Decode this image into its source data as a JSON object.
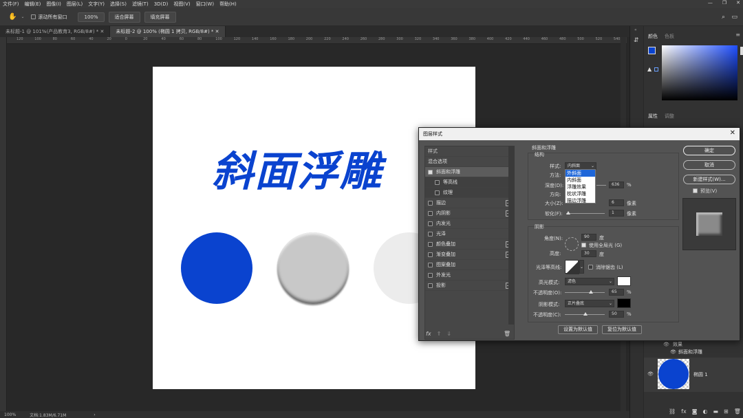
{
  "menubar": {
    "items": [
      "文件(F)",
      "编辑(E)",
      "图像(I)",
      "图层(L)",
      "文字(Y)",
      "选择(S)",
      "滤镜(T)",
      "3D(D)",
      "视图(V)",
      "窗口(W)",
      "帮助(H)"
    ],
    "window_controls": [
      "—",
      "❐",
      "✕"
    ]
  },
  "options_bar": {
    "scroll_all": "滚动所有窗口",
    "zoom": "100%",
    "fit_screen": "适合屏幕",
    "fill_screen": "填充屏幕"
  },
  "tabs": [
    "未标题-1 @ 101%(产品教育3, RGB/8#) *",
    "未标题-2 @ 100% (椭圆 1 拷贝, RGB/8#) *"
  ],
  "ruler_ticks": [
    "120",
    "100",
    "80",
    "60",
    "40",
    "20",
    "0",
    "20",
    "40",
    "60",
    "80",
    "100",
    "120",
    "140",
    "160",
    "180",
    "200",
    "220",
    "240",
    "260",
    "280",
    "300",
    "320",
    "340",
    "360",
    "380",
    "400",
    "420",
    "440",
    "460",
    "480",
    "500",
    "520",
    "540"
  ],
  "canvas": {
    "title_text": "斜面浮雕",
    "title_color": "#0a43cf",
    "circle_colors": [
      "#0a43cf",
      "#c8c8c8",
      "#ececec"
    ]
  },
  "status": {
    "zoom": "100%",
    "doc": "文档:1.83M/6.71M",
    "arrow": "›"
  },
  "right_panel": {
    "color_tabs": [
      "颜色",
      "色板"
    ],
    "props_tabs": [
      "属性",
      "调整"
    ],
    "layers": {
      "effects_label": "效果",
      "bevel_label": "斜面和浮雕",
      "layer_name": "椭圆 1"
    }
  },
  "dialog": {
    "title": "图层样式",
    "close": "✕",
    "styles_header": "样式",
    "blend_options": "混合选项",
    "bevel": "斜面和浮雕",
    "contour": "等高线",
    "texture": "纹理",
    "effects": [
      "描边",
      "内阴影",
      "内发光",
      "光泽",
      "颜色叠加",
      "渐变叠加",
      "图案叠加",
      "外发光",
      "投影"
    ],
    "effects_plus": [
      true,
      true,
      false,
      false,
      true,
      true,
      false,
      false,
      true
    ],
    "fx_label": "fx",
    "section_title": "斜面和浮雕",
    "structure_label": "结构",
    "style_label": "样式:",
    "style_value": "内斜面",
    "method_label": "方法:",
    "depth_label": "深度(D):",
    "depth_value": "636",
    "direction_label": "方向:",
    "size_label": "大小(Z):",
    "size_value": "6",
    "soften_label": "软化(F):",
    "soften_value": "1",
    "percent": "%",
    "pixel": "像素",
    "style_options": [
      "外斜面",
      "内斜面",
      "浮雕效果",
      "枕状浮雕",
      "描边浮雕"
    ],
    "shading_label": "阴影",
    "angle_label": "角度(N):",
    "angle_value": "90",
    "degree": "度",
    "global_light": "使用全局光 (G)",
    "altitude_label": "高度:",
    "altitude_value": "30",
    "gloss_label": "光泽等高线:",
    "antialias": "消除锯齿 (L)",
    "highlight_mode_label": "高光模式:",
    "highlight_mode": "滤色",
    "highlight_opacity_label": "不透明度(O):",
    "highlight_opacity": "65",
    "shadow_mode_label": "阴影模式:",
    "shadow_mode": "正片叠底",
    "shadow_opacity_label": "不透明度(C):",
    "shadow_opacity": "50",
    "make_default": "设置为默认值",
    "reset_default": "复位为默认值",
    "ok": "确定",
    "cancel": "取消",
    "new_style": "新建样式(W)...",
    "preview": "预览(V)"
  }
}
